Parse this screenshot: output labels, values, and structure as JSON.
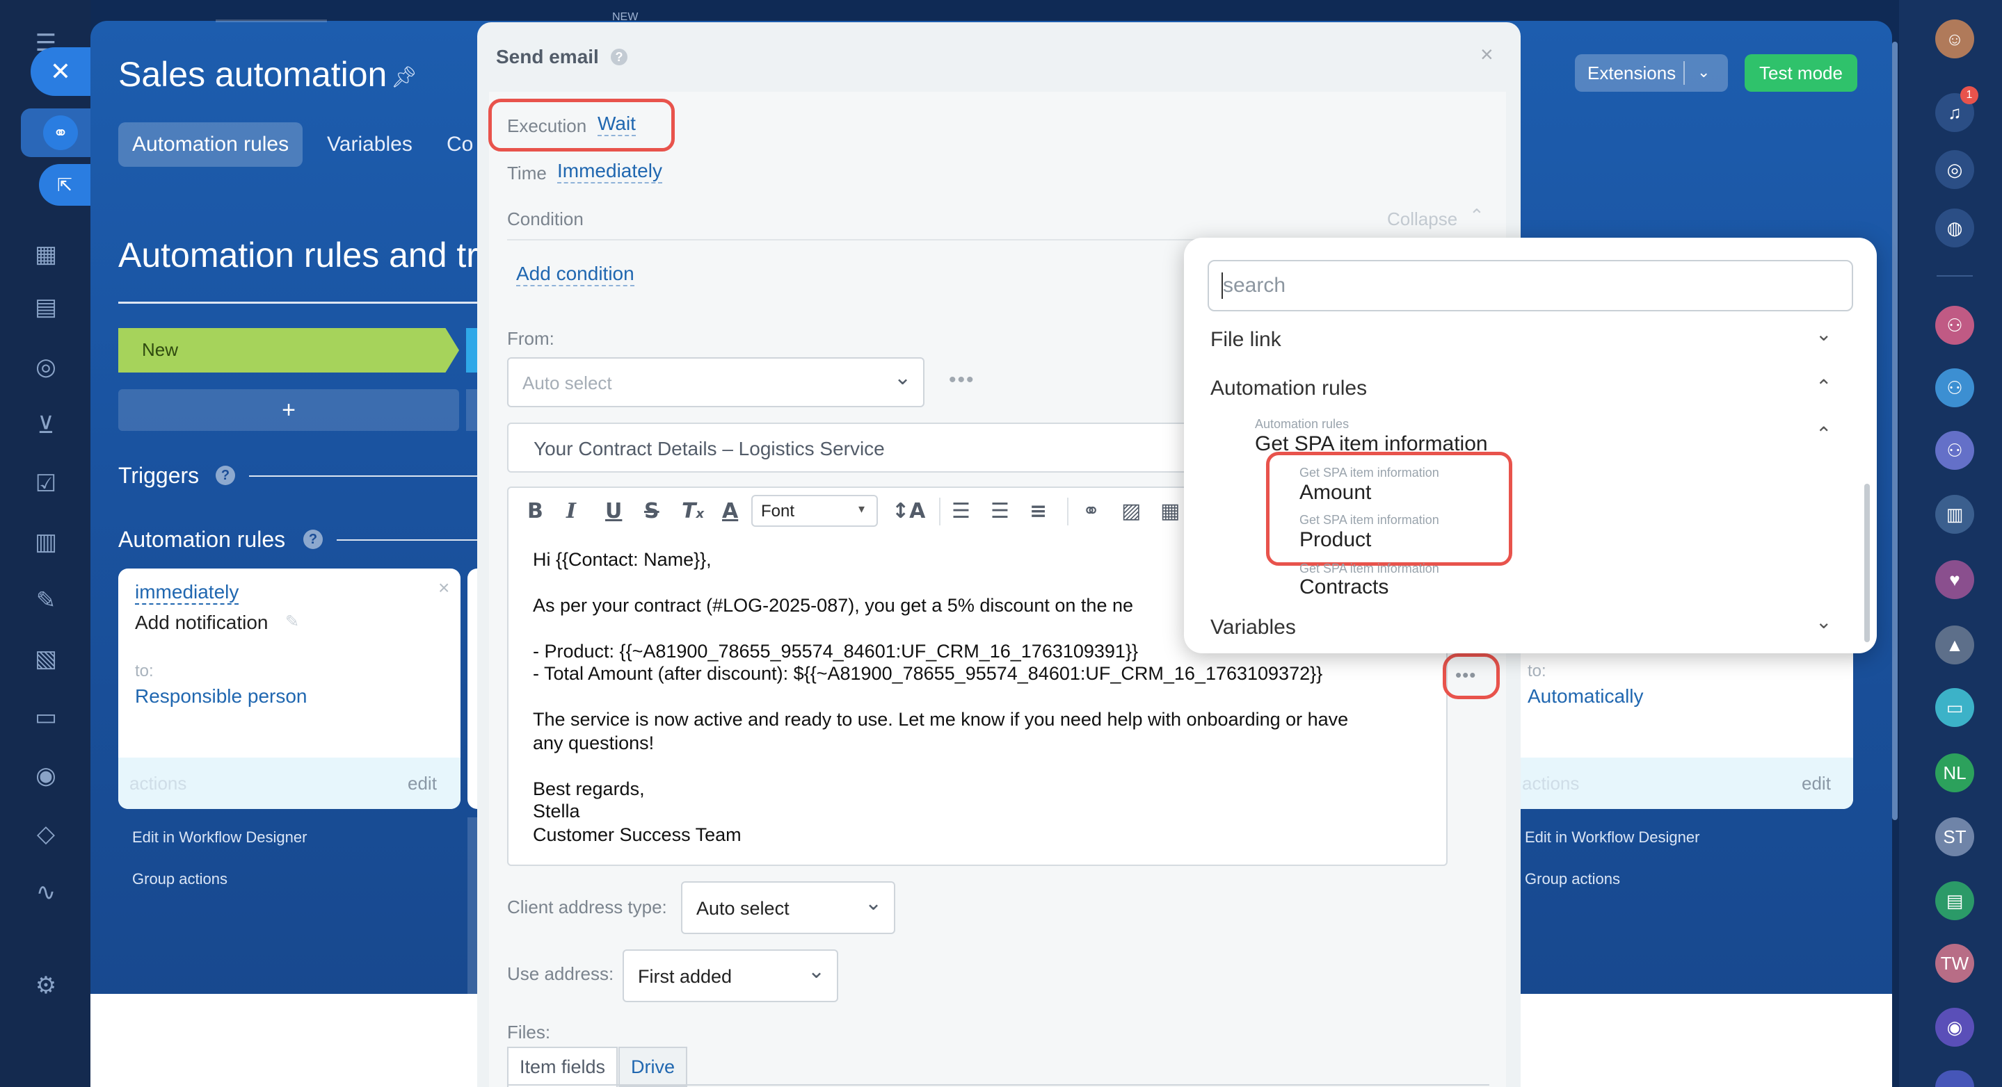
{
  "page": {
    "title": "Sales automation",
    "tabs": [
      "Automation rules",
      "Variables",
      "Co"
    ],
    "section_title": "Automation rules and tr",
    "stage_new": "New",
    "stage_add": "+",
    "triggers": "Triggers",
    "automation_rules": "Automation rules",
    "extensions": "Extensions",
    "test_mode": "Test mode",
    "new_badge": "NEW"
  },
  "left_card": {
    "time": "immediately",
    "action": "Add notification",
    "to_label": "to:",
    "to_value": "Responsible person",
    "actions": "actions",
    "edit": "edit",
    "designer": "Edit in Workflow Designer",
    "group": "Group actions"
  },
  "right_card": {
    "to_label": "to:",
    "to_value": "Automatically",
    "actions": "actions",
    "edit": "edit",
    "designer": "Edit in Workflow Designer",
    "group": "Group actions"
  },
  "right_rail": {
    "notification_count": "1",
    "avatars": [
      "NL",
      "ST",
      "TW"
    ]
  },
  "modal": {
    "title": "Send email",
    "execution_label": "Execution",
    "execution_value": "Wait",
    "time_label": "Time",
    "time_value": "Immediately",
    "condition_label": "Condition",
    "collapse": "Collapse",
    "add_condition": "Add condition",
    "from_label": "From:",
    "from_placeholder": "Auto select",
    "subject": "Your Contract Details – Logistics Service",
    "font_select": "Font",
    "email_lines": [
      "Hi {{Contact: Name}},",
      "As per your contract (#LOG-2025-087), you get a 5% discount on the ne",
      "- Product: {{~A81900_78655_95574_84601:UF_CRM_16_1763109391}}",
      "- Total Amount (after discount): ${{~A81900_78655_95574_84601:UF_CRM_16_1763109372}}",
      "The service is now active and ready to use. Let me know if you need help with onboarding or have",
      "any questions!",
      "Best regards,",
      "Stella",
      "Customer Success Team"
    ],
    "client_address_label": "Client address type:",
    "client_address_value": "Auto select",
    "use_address_label": "Use address:",
    "use_address_value": "First added",
    "files_label": "Files:",
    "file_tabs": [
      "Item fields",
      "Drive"
    ]
  },
  "popup": {
    "search_placeholder": "search",
    "file_link": "File link",
    "automation_rules": "Automation rules",
    "group_small": "Automation rules",
    "group_big": "Get SPA item information",
    "item_small": "Get SPA item information",
    "items": [
      "Amount",
      "Product",
      "Contracts"
    ],
    "variables": "Variables"
  },
  "colors": {
    "accent": "#2067b0",
    "highlight": "#e8534c",
    "test_mode": "#2fc26b",
    "stage_new": "#a6d35b"
  }
}
